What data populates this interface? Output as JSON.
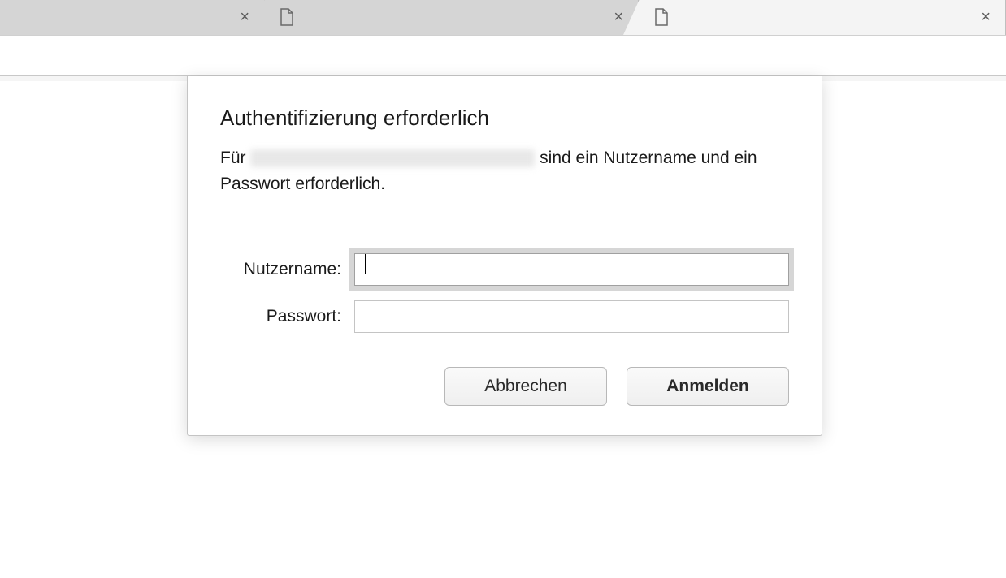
{
  "tabs": {
    "tab1_close": "×",
    "tab2_close": "×",
    "tab3_close": "×"
  },
  "dialog": {
    "title": "Authentifizierung erforderlich",
    "message_prefix": "Für ",
    "message_suffix": " sind ein Nutzername und ein Passwort erforderlich.",
    "username_label": "Nutzername:",
    "password_label": "Passwort:",
    "username_value": "",
    "password_value": "",
    "cancel_label": "Abbrechen",
    "submit_label": "Anmelden"
  }
}
